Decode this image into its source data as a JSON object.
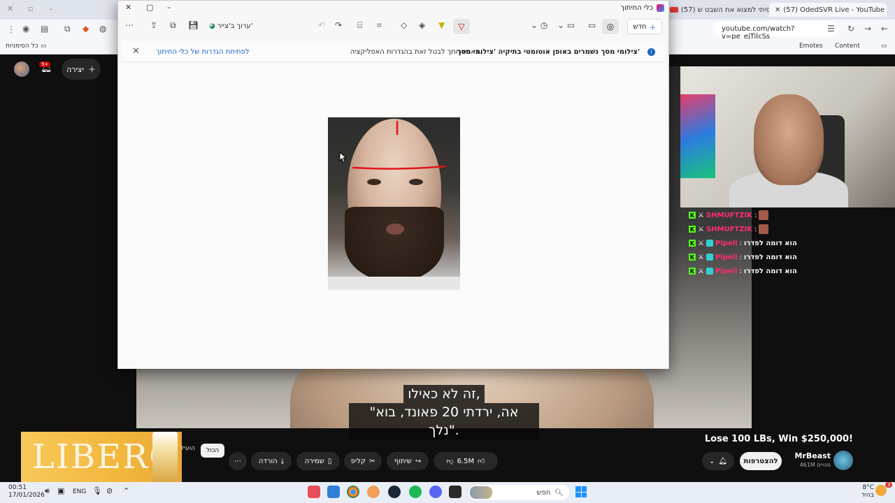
{
  "browser": {
    "tabs": [
      {
        "title": "(57) OdedSVR Live - YouTube",
        "active": true
      },
      {
        "title": "(57) ניסיתי למצוא את השבט ש...",
        "active": false
      }
    ],
    "url": "youtube.com/watch?v=pe_ejTilcSs",
    "bookmarks": {
      "all": "כל הסימניות",
      "emotes": "Emotes",
      "content": "Content"
    }
  },
  "youtube": {
    "create_label": "יצירה",
    "notif_count": "9+",
    "video_title": "Lose 100 LBs, Win $250,000!",
    "channel": "MrBeast",
    "subscribers": "461M מנויים",
    "subscribe_label": "להצטרפות",
    "likes": "6.5M",
    "share_label": "שיתוף",
    "clip_label": "קליפ",
    "save_label": "שמירה",
    "download_label": "הורדה",
    "subtitle_lines": [
      "זה לא כאילו,",
      "\"אה, ירדתי 20 פאונד, בוא נלך\"."
    ],
    "ad_brand": "LIBERO",
    "ad_chip_all": "הכול",
    "ad_chip_related": "הועיל"
  },
  "chat": [
    {
      "user": "SHMUFTZIK",
      "color": "#ff2d6f",
      "msg": ""
    },
    {
      "user": "SHMUFTZIK",
      "color": "#ff2d6f",
      "msg": ""
    },
    {
      "user": "Pipeli",
      "color": "#ff2d6f",
      "msg": "הוא דומה לפדרו"
    },
    {
      "user": "Pipeli",
      "color": "#ff2d6f",
      "msg": "הוא דומה לפדרו"
    },
    {
      "user": "Pipeli",
      "color": "#ff2d6f",
      "msg": "הוא דומה לפדרו"
    }
  ],
  "snipping": {
    "title": "כלי החיתוך",
    "new_label": "חדש",
    "edit_paint_label": "ערוך ב'צייר'",
    "notice_bold": "צילומי מסך נשמרים באופן אוטומטי בתיקיה 'צילומי מסך'",
    "notice_msg": "באפשרותך לבטל זאת בהגדרות האפליקציה.",
    "notice_link": "לפתיחת הגדרות של כלי החיתוך",
    "accent": "#1a64c8"
  },
  "taskbar": {
    "time": "00:51",
    "date": "17/01/2026",
    "lang": "ENG",
    "search_placeholder": "חפש",
    "temp": "8°C",
    "weather": "בהיר",
    "weather_badge": "3"
  }
}
